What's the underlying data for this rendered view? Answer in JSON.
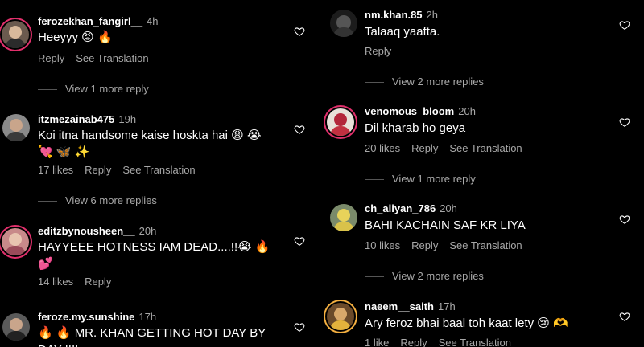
{
  "left": [
    {
      "username": "ferozekhan_fangirl__",
      "time": "4h",
      "text": "Heeyyy 😡 🔥",
      "likes": "",
      "reply": "Reply",
      "translate": "See Translation",
      "more": "View 1 more reply"
    },
    {
      "username": "itzmezainab475",
      "time": "19h",
      "text": "Koi itna handsome kaise hoskta hai 😩 😭 💘 🦋 ✨",
      "likes": "17 likes",
      "reply": "Reply",
      "translate": "See Translation",
      "more": "View 6 more replies"
    },
    {
      "username": "editzbynousheen__",
      "time": "20h",
      "text": "HAYYEEE HOTNESS IAM DEAD....!!😭 🔥 💕",
      "likes": "14 likes",
      "reply": "Reply",
      "translate": "",
      "more": ""
    },
    {
      "username": "feroze.my.sunshine",
      "time": "17h",
      "text": "🔥 🔥 MR. KHAN GETTING HOT DAY BY DAY !!!!",
      "likes": "",
      "reply": "",
      "translate": "",
      "more": ""
    }
  ],
  "right": [
    {
      "username": "nm.khan.85",
      "time": "2h",
      "text": "Talaaq yaafta.",
      "likes": "",
      "reply": "Reply",
      "translate": "",
      "more": "View 2 more replies"
    },
    {
      "username": "venomous_bloom",
      "time": "20h",
      "text": "Dil kharab ho geya",
      "likes": "20 likes",
      "reply": "Reply",
      "translate": "See Translation",
      "more": "View 1 more reply"
    },
    {
      "username": "ch_aliyan_786",
      "time": "20h",
      "text": "BAHI KACHAIN SAF KR LIYA",
      "likes": "10 likes",
      "reply": "Reply",
      "translate": "See Translation",
      "more": "View 2 more replies"
    },
    {
      "username": "naeem__saith",
      "time": "17h",
      "text": "Ary feroz bhai baal toh kaat lety 😢 🫶",
      "likes": "1 like",
      "reply": "Reply",
      "translate": "See Translation",
      "more": ""
    }
  ],
  "icons": {
    "like": "heart-outline-icon"
  }
}
